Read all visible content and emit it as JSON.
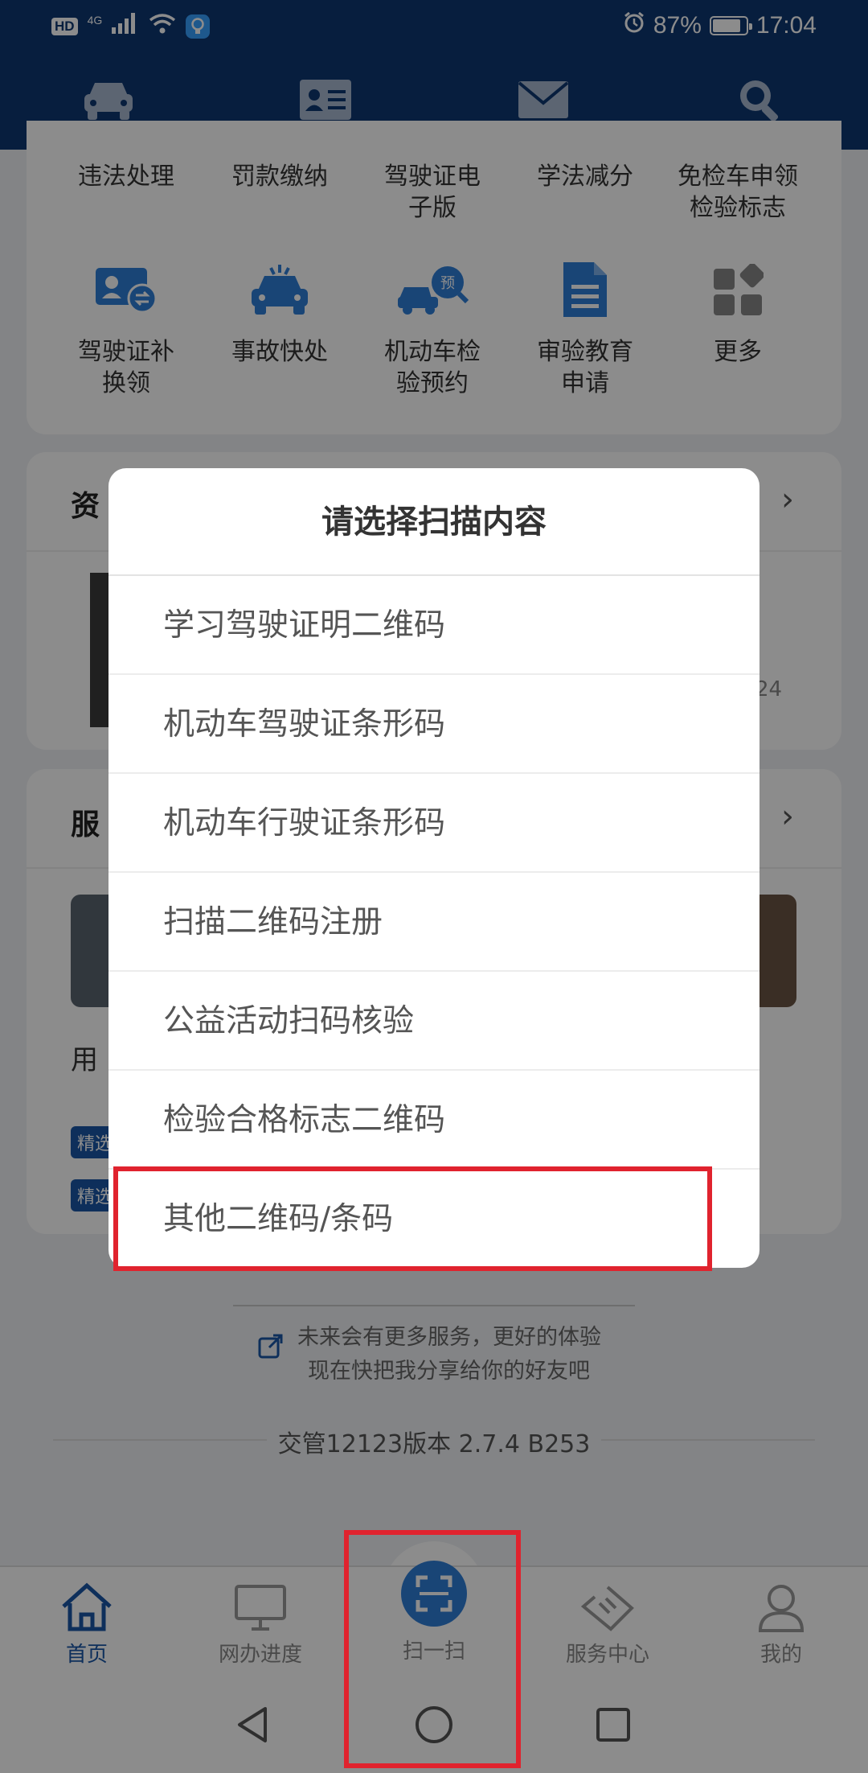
{
  "status_bar": {
    "hd": "HD",
    "network": "4G",
    "battery": "87%",
    "battery_level": 0.87,
    "time": "17:04"
  },
  "top_nav": {
    "icons": [
      "car-icon",
      "id-card-icon",
      "mail-icon",
      "search-icon"
    ]
  },
  "services_row1": [
    {
      "label": "违法处理"
    },
    {
      "label": "罚款缴纳"
    },
    {
      "label": "驾驶证电子版"
    },
    {
      "label": "学法减分"
    },
    {
      "label": "免检车申领检验标志"
    }
  ],
  "services_row2": [
    {
      "label": "驾驶证补换领",
      "icon": "license-renew-icon"
    },
    {
      "label": "事故快处",
      "icon": "accident-icon"
    },
    {
      "label": "机动车检验预约",
      "icon": "inspection-appointment-icon"
    },
    {
      "label": "审验教育申请",
      "icon": "document-icon"
    },
    {
      "label": "更多",
      "icon": "more-grid-icon"
    }
  ],
  "news_section": {
    "title_partial": "资",
    "date_partial": "24"
  },
  "service_section": {
    "title_partial": "服",
    "item_partial": "用",
    "badge1": "精选",
    "badge2": "精选"
  },
  "dialog": {
    "title": "请选择扫描内容",
    "options": [
      "学习驾驶证明二维码",
      "机动车驾驶证条形码",
      "机动车行驶证条形码",
      "扫描二维码注册",
      "公益活动扫码核验",
      "检验合格标志二维码",
      "其他二维码/条码"
    ]
  },
  "footer": {
    "promo_line1": "未来会有更多服务，更好的体验",
    "promo_line2": "现在快把我分享给你的好友吧",
    "version": "交管12123版本 2.7.4 B253"
  },
  "tabbar": {
    "tabs": [
      {
        "label": "首页",
        "icon": "home-icon",
        "active": true
      },
      {
        "label": "网办进度",
        "icon": "monitor-icon",
        "active": false
      },
      {
        "label": "扫一扫",
        "icon": "scan-icon",
        "active": false
      },
      {
        "label": "服务中心",
        "icon": "service-center-icon",
        "active": false
      },
      {
        "label": "我的",
        "icon": "user-icon",
        "active": false
      }
    ]
  },
  "colors": {
    "primary": "#0e3772",
    "accent": "#1a56a6",
    "icon_blue": "#2f7ed8",
    "highlight_red": "#e0232e"
  }
}
